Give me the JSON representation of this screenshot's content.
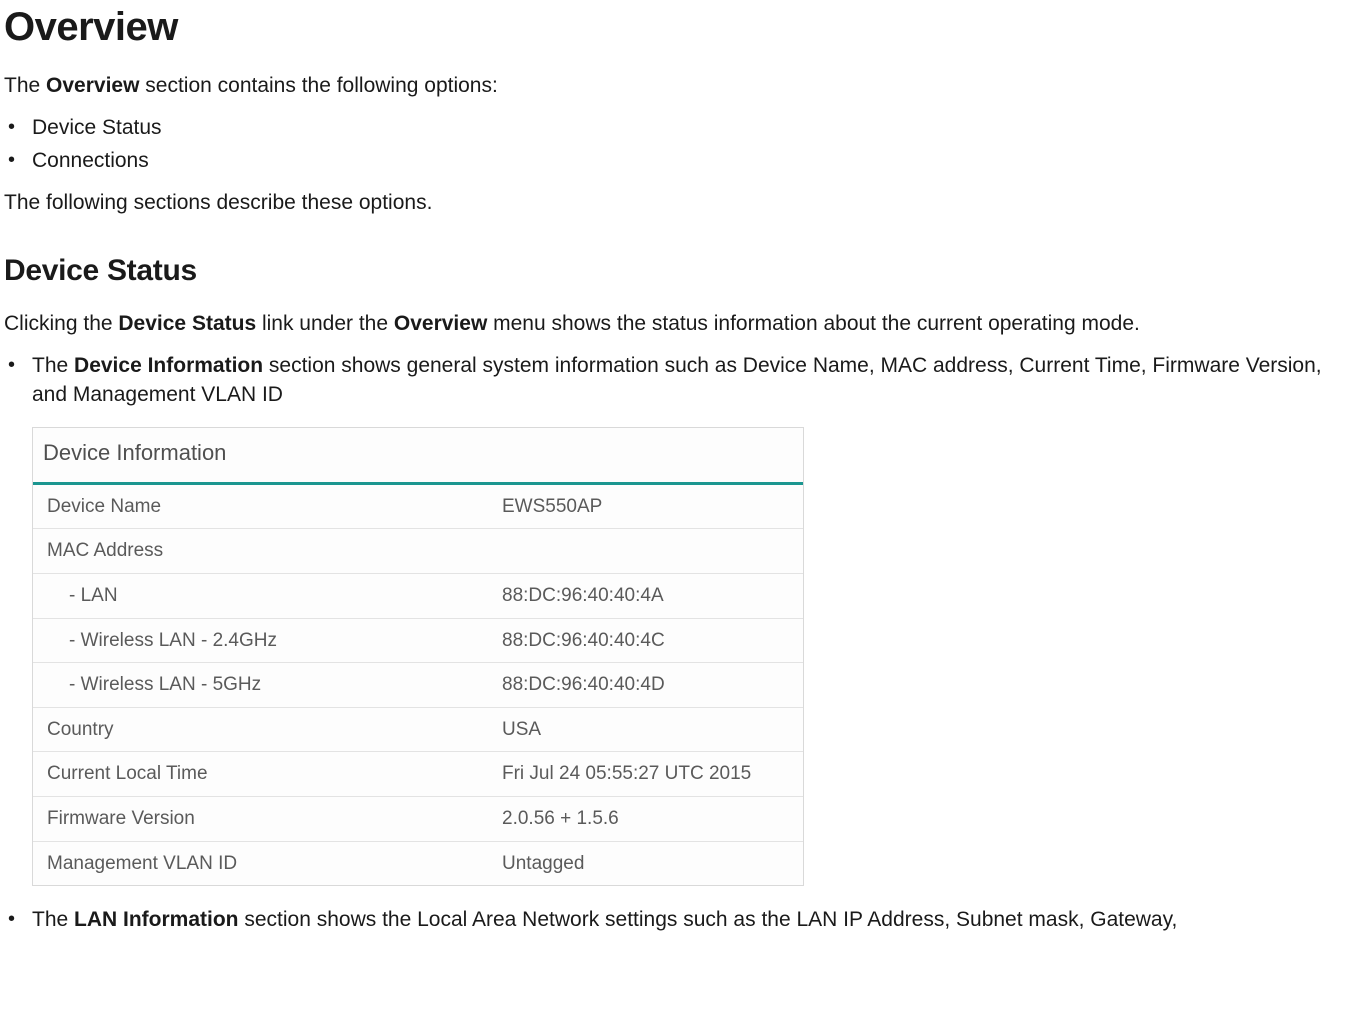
{
  "headings": {
    "overview": "Overview",
    "device_status": "Device Status"
  },
  "intro": {
    "prefix": "The ",
    "bold": "Overview",
    "suffix": " section contains the following options:"
  },
  "options": [
    "Device Status",
    "Connections"
  ],
  "follow_text": "The following sections describe these options.",
  "ds_intro": {
    "prefix": "Clicking the ",
    "bold1": "Device Status",
    "mid": " link under the ",
    "bold2": "Overview",
    "suffix": " menu shows the status information about the current operating mode."
  },
  "bullet_device_info": {
    "prefix": "The ",
    "bold": "Device Information",
    "suffix": " section shows general system information such as Device Name, MAC address, Current Time, Firmware Version, and Management VLAN ID"
  },
  "device_info_panel": {
    "title": "Device Information",
    "rows": [
      {
        "label": "Device Name",
        "value": "EWS550AP",
        "indent": false
      },
      {
        "label": "MAC Address",
        "value": "",
        "indent": false
      },
      {
        "label": "- LAN",
        "value": "88:DC:96:40:40:4A",
        "indent": true
      },
      {
        "label": "- Wireless LAN - 2.4GHz",
        "value": "88:DC:96:40:40:4C",
        "indent": true
      },
      {
        "label": "- Wireless LAN - 5GHz",
        "value": "88:DC:96:40:40:4D",
        "indent": true
      },
      {
        "label": "Country",
        "value": "USA",
        "indent": false
      },
      {
        "label": "Current Local Time",
        "value": "Fri Jul 24 05:55:27 UTC 2015",
        "indent": false
      },
      {
        "label": "Firmware Version",
        "value": "2.0.56 + 1.5.6",
        "indent": false
      },
      {
        "label": "Management VLAN ID",
        "value": "Untagged",
        "indent": false
      }
    ]
  },
  "bullet_lan_info": {
    "prefix": "The ",
    "bold": "LAN Information",
    "suffix": " section shows the Local Area Network settings such as the LAN IP Address, Subnet mask, Gateway,"
  }
}
